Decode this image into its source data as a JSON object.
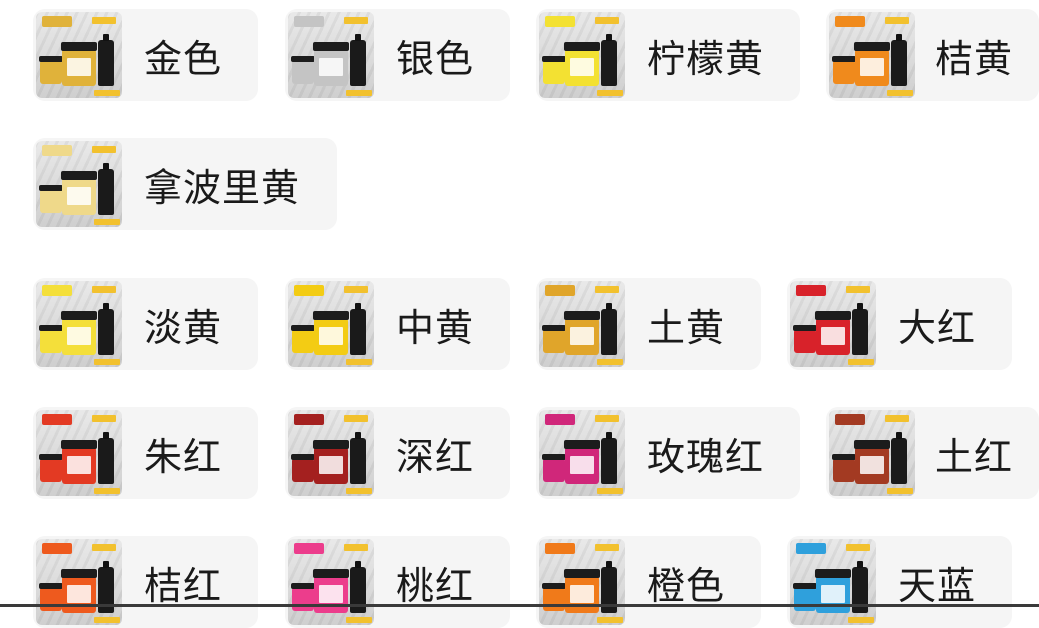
{
  "options": [
    {
      "label": "金色",
      "color": "#e0b23a"
    },
    {
      "label": "银色",
      "color": "#c4c4c4"
    },
    {
      "label": "柠檬黄",
      "color": "#f3e132"
    },
    {
      "label": "桔黄",
      "color": "#f08a1c"
    },
    {
      "label": "拿波里黄",
      "color": "#efd98a"
    },
    {
      "label": "淡黄",
      "color": "#f4df3a"
    },
    {
      "label": "中黄",
      "color": "#f3cc14"
    },
    {
      "label": "土黄",
      "color": "#e0a52a"
    },
    {
      "label": "大红",
      "color": "#d8222a"
    },
    {
      "label": "朱红",
      "color": "#e33a23"
    },
    {
      "label": "深红",
      "color": "#a4201f"
    },
    {
      "label": "玫瑰红",
      "color": "#d0277a"
    },
    {
      "label": "土红",
      "color": "#a33a22"
    },
    {
      "label": "桔红",
      "color": "#ee5a1e"
    },
    {
      "label": "桃红",
      "color": "#ec3d8c"
    },
    {
      "label": "橙色",
      "color": "#f07a1a"
    },
    {
      "label": "天蓝",
      "color": "#2fa0dc"
    }
  ]
}
